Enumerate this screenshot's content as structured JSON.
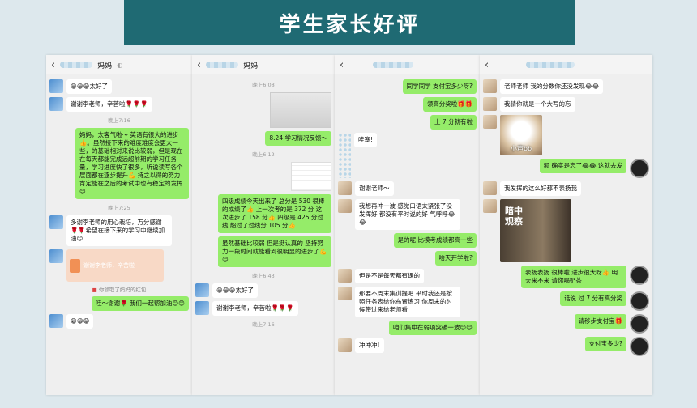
{
  "banner": {
    "title": "学生家长好评"
  },
  "panel1": {
    "title": "妈妈",
    "messages": [
      {
        "side": "left",
        "text": "😁😁😁太好了"
      },
      {
        "side": "left",
        "text": "谢谢李老师，辛苦啦🌹🌹🌹"
      },
      {
        "side": "time",
        "text": "晚上7:16"
      },
      {
        "side": "right",
        "text": "妈妈，太客气啦～ 英语有很大的进步👍。虽然接下来的难度难度会更大一些，的基础相对来说比较弱，但是现在在每天都能完成远超前期的学习任务量，学习进度快了很多，听说读写各个层面都在逐步提升💪 持之以得的努力肯定能在之后的考试中也有稳定的发挥😊"
      },
      {
        "side": "time",
        "text": "晚上7:25"
      },
      {
        "side": "left",
        "text": "多谢李老师的用心栽培，万分感谢🌹🌹希望在接下来的学习中继续加油😊"
      },
      {
        "side": "redpacket",
        "text": "谢谢李老师，辛苦啦"
      },
      {
        "side": "sys",
        "text": "你领取了妈妈的红包"
      },
      {
        "side": "right",
        "text": "哇～谢谢🌹 我们一起帮加油😊😊"
      },
      {
        "side": "left",
        "text": "😁😁😁"
      }
    ]
  },
  "panel2": {
    "title": "妈妈",
    "messages": [
      {
        "side": "time",
        "text": "晚上6:08"
      },
      {
        "side": "image-note",
        "text": ""
      },
      {
        "side": "right",
        "text": "8.24 学习情况反馈～"
      },
      {
        "side": "time",
        "text": "晚上6:12"
      },
      {
        "side": "image-sheet",
        "text": ""
      },
      {
        "side": "right",
        "text": "四级成绩今天出来了 总分是 530 很棒的成绩了👍 上一次考的是 372 分 这次进步了 158 分👍 四级是 425 分过线 超过了过线分 105 分👍"
      },
      {
        "side": "right",
        "text": "虽然基础比较弱 但是挺认真的 坚持努力一段时间就能看到很明显的进步了💪😊"
      },
      {
        "side": "time",
        "text": "晚上6:43"
      },
      {
        "side": "left",
        "text": "😁😁😁太好了"
      },
      {
        "side": "left",
        "text": "谢谢李老师，辛苦啦🌹🌹🌹"
      },
      {
        "side": "time",
        "text": "晚上7:16"
      }
    ]
  },
  "panel3": {
    "messages": [
      {
        "side": "right",
        "text": "同学同学 支付宝多少呀?"
      },
      {
        "side": "right",
        "text": "领高分奖啦🎁🎁"
      },
      {
        "side": "right",
        "text": "上 7 分就有啦"
      },
      {
        "side": "left",
        "text": "哇塞!"
      },
      {
        "side": "left",
        "text": "谢谢老师～"
      },
      {
        "side": "left",
        "text": "我想再冲一波 感觉口语太紧张了没发挥好 都没有平时说的好 气呼呼😂😂"
      },
      {
        "side": "right",
        "text": "是的呢 比模考成绩都高一些"
      },
      {
        "side": "right",
        "text": "啥天开学啦?"
      },
      {
        "side": "left",
        "text": "但是不是每天都有课的"
      },
      {
        "side": "right",
        "text": "那要不周末集训提吧 平时我还是按照任务表给你布置练习 你周末的时候带过来给老师看"
      },
      {
        "side": "right",
        "text": "咱们集中在弱项突破一波😊😊"
      },
      {
        "side": "left",
        "text": "冲冲冲!"
      }
    ]
  },
  "panel4": {
    "messages": [
      {
        "side": "left",
        "text": "老师老师 我的分数你还没发现😂😂"
      },
      {
        "side": "left",
        "text": "我猜你就是一个大写的忘"
      },
      {
        "side": "image-cat",
        "text": "小声bb"
      },
      {
        "side": "right",
        "text": "额 确实是忘了😂😂 这就去发"
      },
      {
        "side": "left",
        "text": "我发挥的这么好都不表扬我"
      },
      {
        "side": "image-man",
        "text": "暗中观察"
      },
      {
        "side": "right",
        "text": "表扬表扬 很棒啦 进步很大呀👍 明天来不来 请你喝奶茶"
      },
      {
        "side": "right",
        "text": "话说 过 7 分有高分奖"
      },
      {
        "side": "right",
        "text": "请移步支付宝🎁"
      },
      {
        "side": "right",
        "text": "支付宝多少?"
      }
    ]
  }
}
